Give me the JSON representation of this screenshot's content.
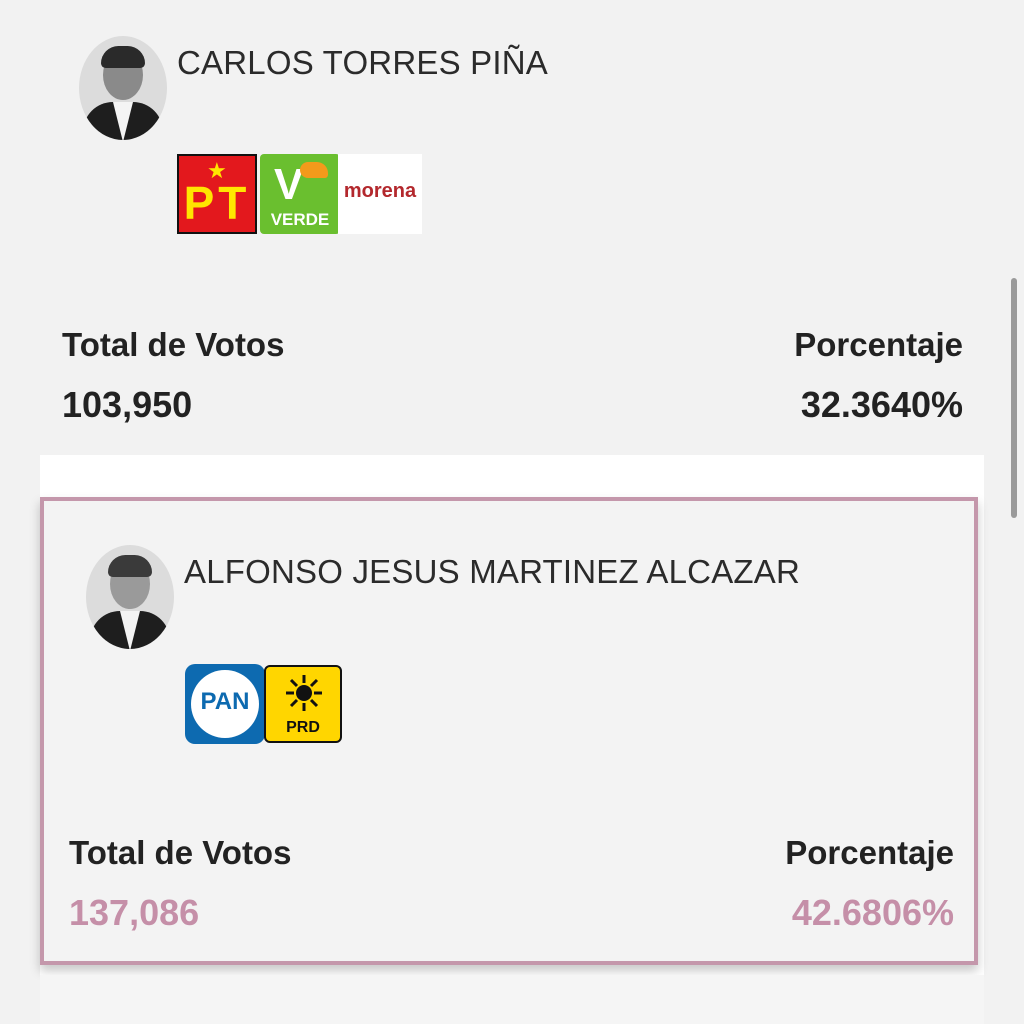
{
  "candidates": [
    {
      "name": "CARLOS TORRES PIÑA",
      "parties": [
        {
          "label": "PT",
          "color": "#e3181d"
        },
        {
          "label": "VERDE",
          "color": "#6abf2f"
        },
        {
          "label": "morena",
          "color": "#b3282d"
        }
      ],
      "votes_label": "Total de Votos",
      "votes": "103,950",
      "percent_label": "Porcentaje",
      "percent": "32.3640%",
      "highlighted": false
    },
    {
      "name": "ALFONSO JESUS MARTINEZ ALCAZAR",
      "parties": [
        {
          "label": "PAN",
          "color": "#0d6ab0"
        },
        {
          "label": "PRD",
          "color": "#ffd600"
        }
      ],
      "votes_label": "Total de Votos",
      "votes": "137,086",
      "percent_label": "Porcentaje",
      "percent": "42.6806%",
      "highlighted": true,
      "accent_color": "#c58fa8"
    }
  ]
}
